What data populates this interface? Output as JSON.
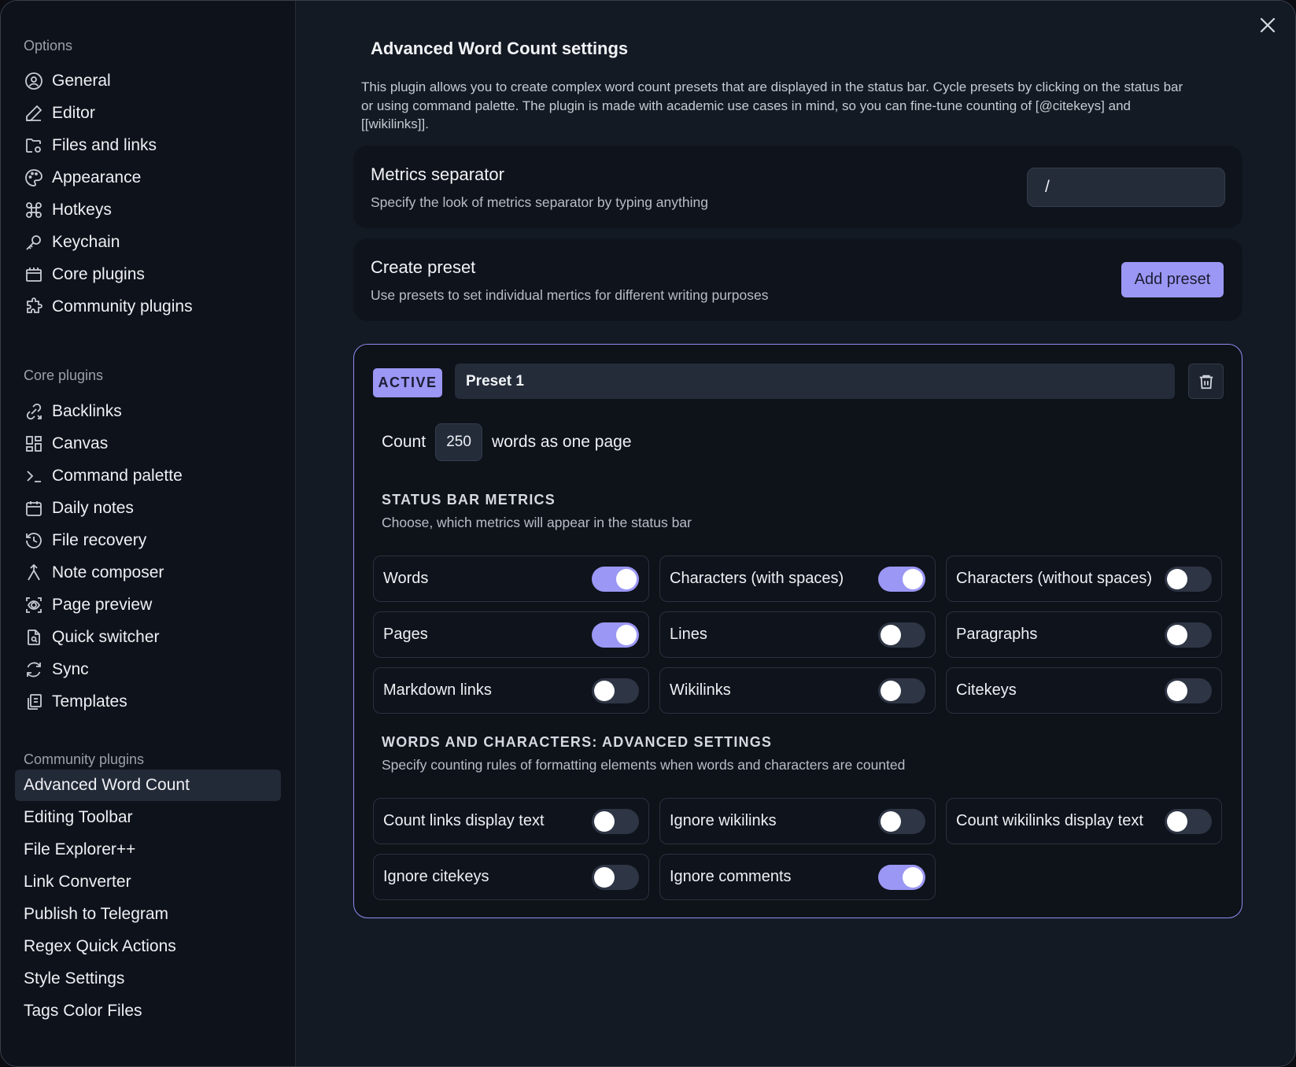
{
  "sidebar": {
    "options_heading": "Options",
    "options": [
      {
        "label": "General",
        "icon": "user-circle-icon"
      },
      {
        "label": "Editor",
        "icon": "pencil-icon"
      },
      {
        "label": "Files and links",
        "icon": "folder-cog-icon"
      },
      {
        "label": "Appearance",
        "icon": "palette-icon"
      },
      {
        "label": "Hotkeys",
        "icon": "command-icon"
      },
      {
        "label": "Keychain",
        "icon": "key-icon"
      },
      {
        "label": "Core plugins",
        "icon": "box-icon"
      },
      {
        "label": "Community plugins",
        "icon": "puzzle-icon"
      }
    ],
    "core_heading": "Core plugins",
    "core": [
      {
        "label": "Backlinks",
        "icon": "backlinks-icon"
      },
      {
        "label": "Canvas",
        "icon": "canvas-icon"
      },
      {
        "label": "Command palette",
        "icon": "terminal-icon"
      },
      {
        "label": "Daily notes",
        "icon": "calendar-icon"
      },
      {
        "label": "File recovery",
        "icon": "history-icon"
      },
      {
        "label": "Note composer",
        "icon": "merge-icon"
      },
      {
        "label": "Page preview",
        "icon": "page-preview-icon"
      },
      {
        "label": "Quick switcher",
        "icon": "quick-switcher-icon"
      },
      {
        "label": "Sync",
        "icon": "sync-icon"
      },
      {
        "label": "Templates",
        "icon": "templates-icon"
      }
    ],
    "community_heading": "Community plugins",
    "community": [
      "Advanced Word Count",
      "Editing Toolbar",
      "File Explorer++",
      "Link Converter",
      "Publish to Telegram",
      "Regex Quick Actions",
      "Style Settings",
      "Tags Color Files"
    ],
    "active_item": "Advanced Word Count"
  },
  "main": {
    "title": "Advanced Word Count settings",
    "description": "This plugin allows you to create complex word count presets that are displayed in the status bar. Cycle presets by clicking on the status bar or using command palette. The plugin is made with academic use cases in mind, so you can fine-tune counting of [@citekeys] and [[wikilinks]].",
    "separator": {
      "title": "Metrics separator",
      "desc": "Specify the look of metrics separator by typing anything",
      "value": "/"
    },
    "create_preset": {
      "title": "Create preset",
      "desc": "Use presets to set individual mertics for different writing purposes",
      "button": "Add preset"
    },
    "preset": {
      "badge": "ACTIVE",
      "name": "Preset 1",
      "count_label": "Count",
      "count_value": "250",
      "count_suffix": "words as one page",
      "metrics_heading": "STATUS BAR METRICS",
      "metrics_desc": "Choose, which metrics will appear in the status bar",
      "metrics": [
        {
          "label": "Words",
          "on": true
        },
        {
          "label": "Characters (with spaces)",
          "on": true
        },
        {
          "label": "Characters (without spaces)",
          "on": false
        },
        {
          "label": "Pages",
          "on": true
        },
        {
          "label": "Lines",
          "on": false
        },
        {
          "label": "Paragraphs",
          "on": false
        },
        {
          "label": "Markdown links",
          "on": false
        },
        {
          "label": "Wikilinks",
          "on": false
        },
        {
          "label": "Citekeys",
          "on": false
        }
      ],
      "advanced_heading": "WORDS AND CHARACTERS: ADVANCED SETTINGS",
      "advanced_desc": "Specify counting rules of formatting elements when words and characters are counted",
      "advanced": [
        {
          "label": "Count links display text",
          "on": false
        },
        {
          "label": "Ignore wikilinks",
          "on": false
        },
        {
          "label": "Count wikilinks display text",
          "on": false
        },
        {
          "label": "Ignore citekeys",
          "on": false
        },
        {
          "label": "Ignore comments",
          "on": true
        }
      ]
    }
  },
  "colors": {
    "accent": "#9b97f5",
    "background": "#141a24",
    "sidebar": "#0e121a"
  }
}
